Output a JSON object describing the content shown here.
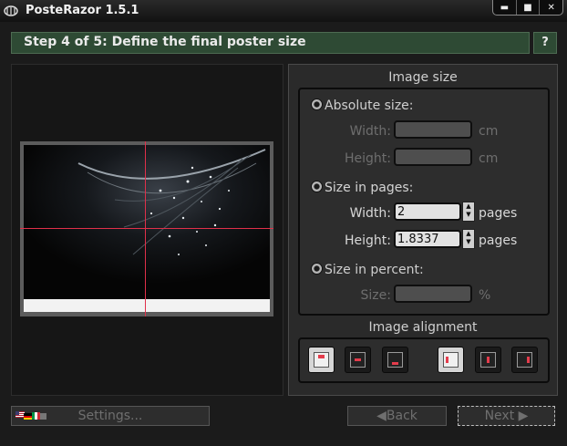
{
  "window": {
    "title": "PosteRazor 1.5.1",
    "controls": [
      "minimize-icon",
      "maximize-icon",
      "close-icon"
    ]
  },
  "step": {
    "title": "Step 4 of 5: Define the final poster size",
    "help_label": "?"
  },
  "image_size": {
    "title": "Image size",
    "absolute": {
      "label": "Absolute size:",
      "width_label": "Width:",
      "height_label": "Height:",
      "width_value": "",
      "height_value": "",
      "unit": "cm"
    },
    "pages": {
      "label": "Size in pages:",
      "width_label": "Width:",
      "height_label": "Height:",
      "width_value": "2",
      "height_value": "1.8337",
      "unit": "pages"
    },
    "percent": {
      "label": "Size in percent:",
      "size_label": "Size:",
      "size_value": "",
      "unit": "%"
    }
  },
  "image_alignment": {
    "title": "Image alignment",
    "options": [
      "top",
      "center",
      "bottom",
      "left",
      "center",
      "right"
    ]
  },
  "buttons": {
    "settings": "Settings...",
    "back": "Back",
    "next": "Next"
  },
  "colors": {
    "header_bg": "#2e4a34",
    "guide": "#e0304a"
  }
}
